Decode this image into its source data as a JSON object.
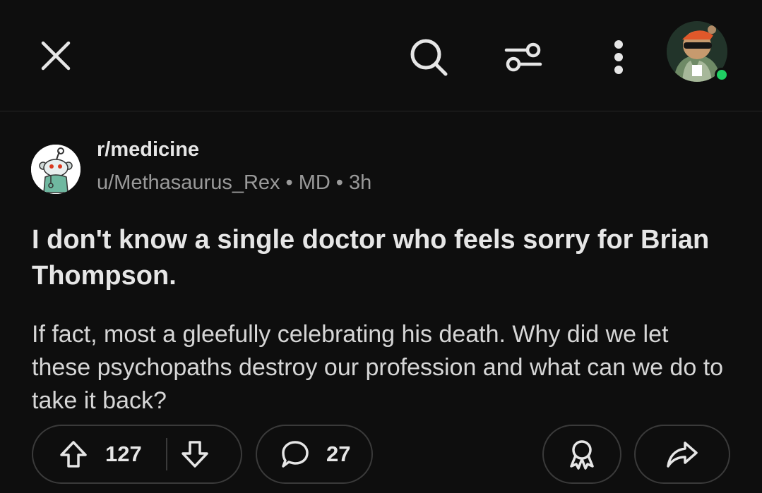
{
  "header": {
    "close_icon": "close-icon",
    "search_icon": "search-icon",
    "filter_icon": "filter-sliders-icon",
    "more_icon": "more-vertical-icon",
    "status_color": "#1fcf63"
  },
  "post": {
    "subreddit": "r/medicine",
    "username": "u/Methasaurus_Rex",
    "flair": "MD",
    "age": "3h",
    "separator": "•",
    "title": "I don't know a single doctor who feels sorry for Brian Thompson.",
    "body": "If fact, most a gleefully celebrating his death.  Why did we let these psychopaths destroy our profession and what can we do to take it back?"
  },
  "actions": {
    "upvotes": "127",
    "comments": "27",
    "upvote_icon": "upvote-icon",
    "downvote_icon": "downvote-icon",
    "comment_icon": "comment-icon",
    "award_icon": "award-icon",
    "share_icon": "share-icon"
  }
}
